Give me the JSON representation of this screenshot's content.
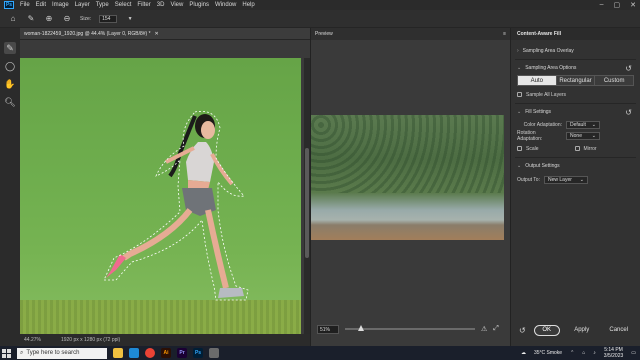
{
  "menubar": {
    "logo": "Ps",
    "items": [
      "File",
      "Edit",
      "Image",
      "Layer",
      "Type",
      "Select",
      "Filter",
      "3D",
      "View",
      "Plugins",
      "Window",
      "Help"
    ]
  },
  "options": {
    "size_label": "Size:",
    "size_value": "154"
  },
  "document": {
    "tab_title": "woman-1822459_1920.jpg @ 44.4% (Layer 0, RGB/8#) *",
    "status_zoom": "44.27%",
    "status_info": "1920 px x 1280 px (72 ppi)"
  },
  "preview": {
    "title": "Preview",
    "zoom": "51%",
    "zoom_level_fraction": 0.1
  },
  "caf": {
    "title": "Content-Aware Fill",
    "sampling_overlay": "Sampling Area Overlay",
    "sampling_options": "Sampling Area Options",
    "modes": [
      "Auto",
      "Rectangular",
      "Custom"
    ],
    "active_mode": "Auto",
    "sample_all_layers": "Sample All Layers",
    "fill_settings": "Fill Settings",
    "color_adaptation_label": "Color Adaptation:",
    "color_adaptation_value": "Default",
    "rotation_adaptation_label": "Rotation Adaptation:",
    "rotation_adaptation_value": "None",
    "scale_label": "Scale",
    "mirror_label": "Mirror",
    "output_settings": "Output Settings",
    "output_to_label": "Output To:",
    "output_to_value": "New Layer",
    "ok": "OK",
    "apply": "Apply",
    "cancel": "Cancel"
  },
  "taskbar": {
    "search_placeholder": "Type here to search",
    "weather": "35°C  Smoke",
    "time": "5:14 PM",
    "date": "3/5/2023"
  },
  "colors": {
    "accent": "#31a8ff",
    "selected_mode": "#e6e6e6"
  }
}
